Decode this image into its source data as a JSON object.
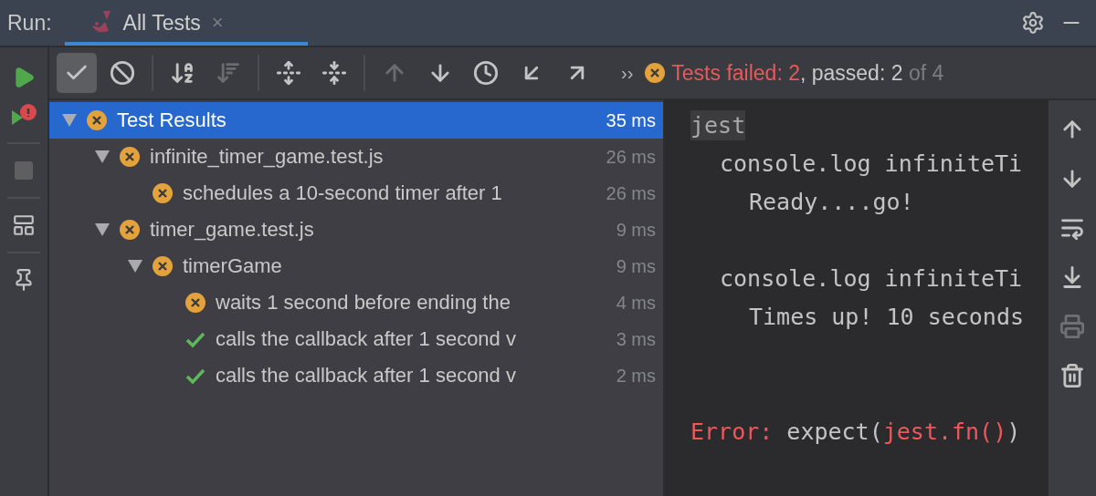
{
  "run_label": "Run:",
  "tabs": [
    {
      "label": "All Tests",
      "selected": true,
      "close": "×"
    }
  ],
  "side_toolbar": [
    {
      "disabled": false
    },
    {
      "disabled": false
    },
    {
      "disabled": true
    },
    {
      "disabled": false
    },
    {
      "disabled": false
    }
  ],
  "toolbar": [
    {
      "toggled": true,
      "disabled": false
    },
    {
      "toggled": false,
      "disabled": false
    },
    {
      "toggled": false,
      "disabled": false
    },
    {
      "toggled": false,
      "disabled": true
    },
    {
      "toggled": false,
      "disabled": false
    },
    {
      "toggled": false,
      "disabled": false
    },
    {
      "toggled": false,
      "disabled": true
    },
    {
      "toggled": false,
      "disabled": false
    },
    {
      "toggled": false,
      "disabled": false
    },
    {
      "toggled": false,
      "disabled": false
    },
    {
      "toggled": false,
      "disabled": false
    }
  ],
  "overflow": "››",
  "status": {
    "kind": "failed",
    "segments": [
      {
        "kind": "error",
        "text": "Tests failed: 2"
      },
      {
        "kind": "normal",
        "text": ", passed: 2"
      },
      {
        "kind": "dim",
        "text": " of 4"
      }
    ]
  },
  "tree": [
    {
      "name": "Test Results",
      "time": "35 ms",
      "kind": "failed",
      "selected": true,
      "expanded": true,
      "children": [
        {
          "name": "infinite_timer_game.test.js",
          "time": "26 ms",
          "kind": "failed",
          "selected": false,
          "expanded": true,
          "children": [
            {
              "name": "schedules a 10-second timer after 1",
              "time": "26 ms",
              "kind": "failed",
              "selected": false
            }
          ]
        },
        {
          "name": "timer_game.test.js",
          "time": "9 ms",
          "kind": "failed",
          "selected": false,
          "expanded": true,
          "children": [
            {
              "name": "timerGame",
              "time": "9 ms",
              "kind": "failed",
              "selected": false,
              "expanded": true,
              "children": [
                {
                  "name": "waits 1 second before ending the",
                  "time": "4 ms",
                  "kind": "failed",
                  "selected": false
                },
                {
                  "name": "calls the callback after 1 second v",
                  "time": "3 ms",
                  "kind": "passed",
                  "selected": false
                },
                {
                  "name": "calls the callback after 1 second v",
                  "time": "2 ms",
                  "kind": "passed",
                  "selected": false
                }
              ]
            }
          ]
        }
      ]
    }
  ],
  "console": [
    {
      "kind": "header",
      "text": "jest"
    },
    {
      "kind": "indent1",
      "segments": [
        {
          "kind": "normal",
          "text": "console.log infiniteTi"
        }
      ]
    },
    {
      "kind": "indent2",
      "segments": [
        {
          "kind": "normal",
          "text": "Ready....go!"
        }
      ]
    },
    {
      "kind": "blank"
    },
    {
      "kind": "indent1",
      "segments": [
        {
          "kind": "normal",
          "text": "console.log infiniteTi"
        }
      ]
    },
    {
      "kind": "indent2",
      "segments": [
        {
          "kind": "normal",
          "text": "Times up! 10 seconds"
        }
      ]
    },
    {
      "kind": "blank"
    },
    {
      "kind": "blank"
    },
    {
      "kind": "plain",
      "segments": [
        {
          "kind": "error",
          "text": "Error:"
        },
        {
          "kind": "normal",
          "text": " expect("
        },
        {
          "kind": "error",
          "text": "jest.fn()"
        },
        {
          "kind": "normal",
          "text": ")"
        }
      ]
    }
  ],
  "console_toolbar": [
    {
      "disabled": false
    },
    {
      "disabled": false
    },
    {
      "disabled": false
    },
    {
      "disabled": false
    },
    {
      "disabled": true
    },
    {
      "disabled": false
    }
  ]
}
